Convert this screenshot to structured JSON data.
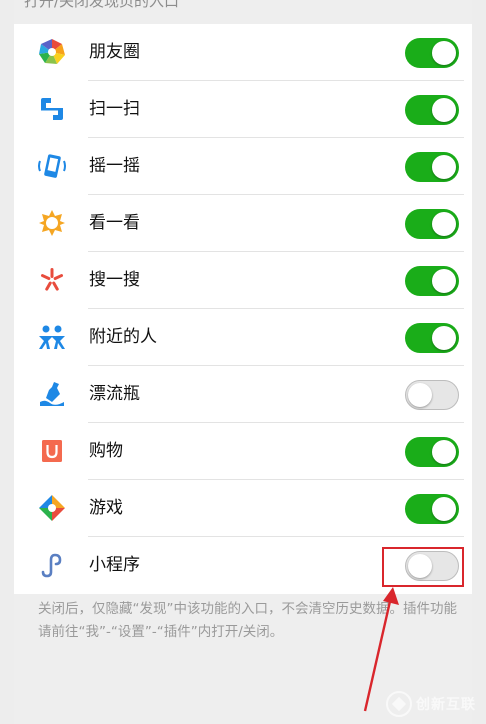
{
  "section_header": "打开/关闭发现页的入口",
  "items": [
    {
      "label": "朋友圈",
      "icon": "moments-icon",
      "on": true
    },
    {
      "label": "扫一扫",
      "icon": "scan-icon",
      "on": true
    },
    {
      "label": "摇一摇",
      "icon": "shake-icon",
      "on": true
    },
    {
      "label": "看一看",
      "icon": "top-stories-icon",
      "on": true
    },
    {
      "label": "搜一搜",
      "icon": "search-icon",
      "on": true
    },
    {
      "label": "附近的人",
      "icon": "people-nearby-icon",
      "on": true
    },
    {
      "label": "漂流瓶",
      "icon": "drift-bottle-icon",
      "on": false
    },
    {
      "label": "购物",
      "icon": "shopping-icon",
      "on": true
    },
    {
      "label": "游戏",
      "icon": "games-icon",
      "on": true
    },
    {
      "label": "小程序",
      "icon": "mini-programs-icon",
      "on": false
    }
  ],
  "footer_note": "关闭后，仅隐藏“发现”中该功能的入口，不会清空历史数据。插件功能请前往“我”-“设置”-“插件”内打开/关闭。",
  "watermark": "创新互联",
  "colors": {
    "toggle_on": "#1aad19",
    "toggle_off": "#e6e6e6",
    "annotation": "#d9262c"
  }
}
